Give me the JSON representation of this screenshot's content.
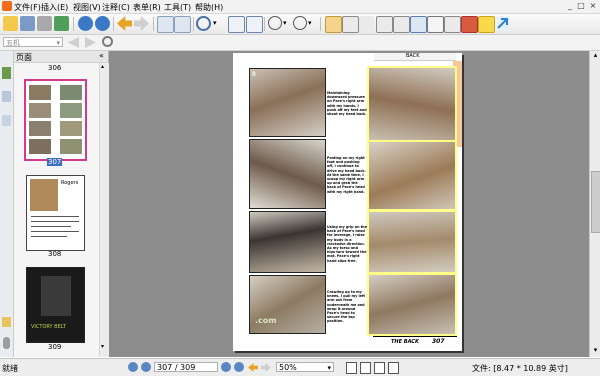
{
  "menubar": {
    "items": [
      "文件(F)",
      "插入(E)",
      "视图(V)",
      "注释(C)",
      "表单(R)",
      "工具(T)",
      "帮助(H)"
    ],
    "window_controls": [
      "_",
      "□",
      "×"
    ]
  },
  "toolbar2": {
    "page_select_value": "五机",
    "page_select_arrow": "▾"
  },
  "thumbnails": {
    "header": "页面",
    "close": "«",
    "labels": [
      "306",
      "307",
      "308",
      "309"
    ],
    "cover_text_308": "Rogers",
    "cover_text_309": "VICTORY BELT"
  },
  "document": {
    "header_tag": "BACK",
    "footer_title": "THE BACK",
    "footer_page": "307",
    "captions": [
      "Maintaining downward pressure on Pace's right arm with my hands, I push off my feet and shoot my head back.",
      "Posting on my right foot and pushing off, I continue to drive my head back. At the same time, I scoop my right arm up and grab the back of Pace's head with my right hand.",
      "Using my grip on the back of Pace's head for leverage, I raise my body in a clockwise direction. As my torso and hips turn toward the mat, Pace's right hand slips free.",
      "Crawling up to my knees, I pull my left arm out from underneath me and wrap it around Pace's head to secure the top position."
    ],
    "watermark": ".com"
  },
  "statusbar": {
    "ready": "就绪",
    "page_value": "307 / 309",
    "zoom_value": "50%",
    "doc_size": "文件: [8.47 * 10.89 英寸]"
  },
  "colors": {
    "accent": "#ffff88",
    "selected_thumb_border": "#d23a8c",
    "background": "#8d8d8d",
    "sidebar_tab_orange": "#f7c79a"
  }
}
